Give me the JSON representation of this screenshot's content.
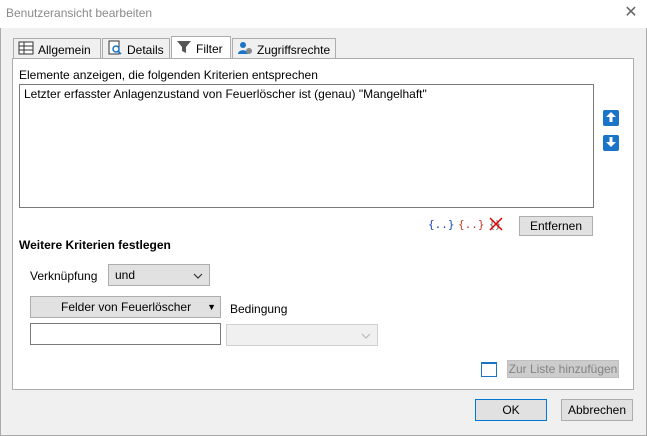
{
  "window": {
    "title": "Benutzeransicht bearbeiten",
    "close_glyph": "✕"
  },
  "tabs": [
    {
      "label": "Allgemein",
      "icon": "grid-icon"
    },
    {
      "label": "Details",
      "icon": "magnifier-document-icon"
    },
    {
      "label": "Filter",
      "icon": "funnel-icon",
      "active": true
    },
    {
      "label": "Zugriffsrechte",
      "icon": "users-icon"
    }
  ],
  "filter": {
    "criteria_heading": "Elemente anzeigen, die folgenden Kriterien entsprechen",
    "criteria": [
      "Letzter erfasster Anlagenzustand von Feuerlöscher ist (genau) \"Mangelhaft\""
    ],
    "group_symbol_blue": "{..}",
    "group_symbol_red": "{..}",
    "remove_label": "Entfernen",
    "more_heading": "Weitere Kriterien festlegen",
    "link_label": "Verknüpfung",
    "link_value": "und",
    "fields_button": "Felder von Feuerlöscher",
    "condition_label": "Bedingung",
    "field_value": "",
    "condition_value": "",
    "add_to_list": "Zur Liste hinzufügen"
  },
  "footer": {
    "ok": "OK",
    "cancel": "Abbrechen"
  },
  "colors": {
    "accent": "#0078d7",
    "arrow_button": "#1a74c8",
    "red_symbol": "#c0392b"
  }
}
